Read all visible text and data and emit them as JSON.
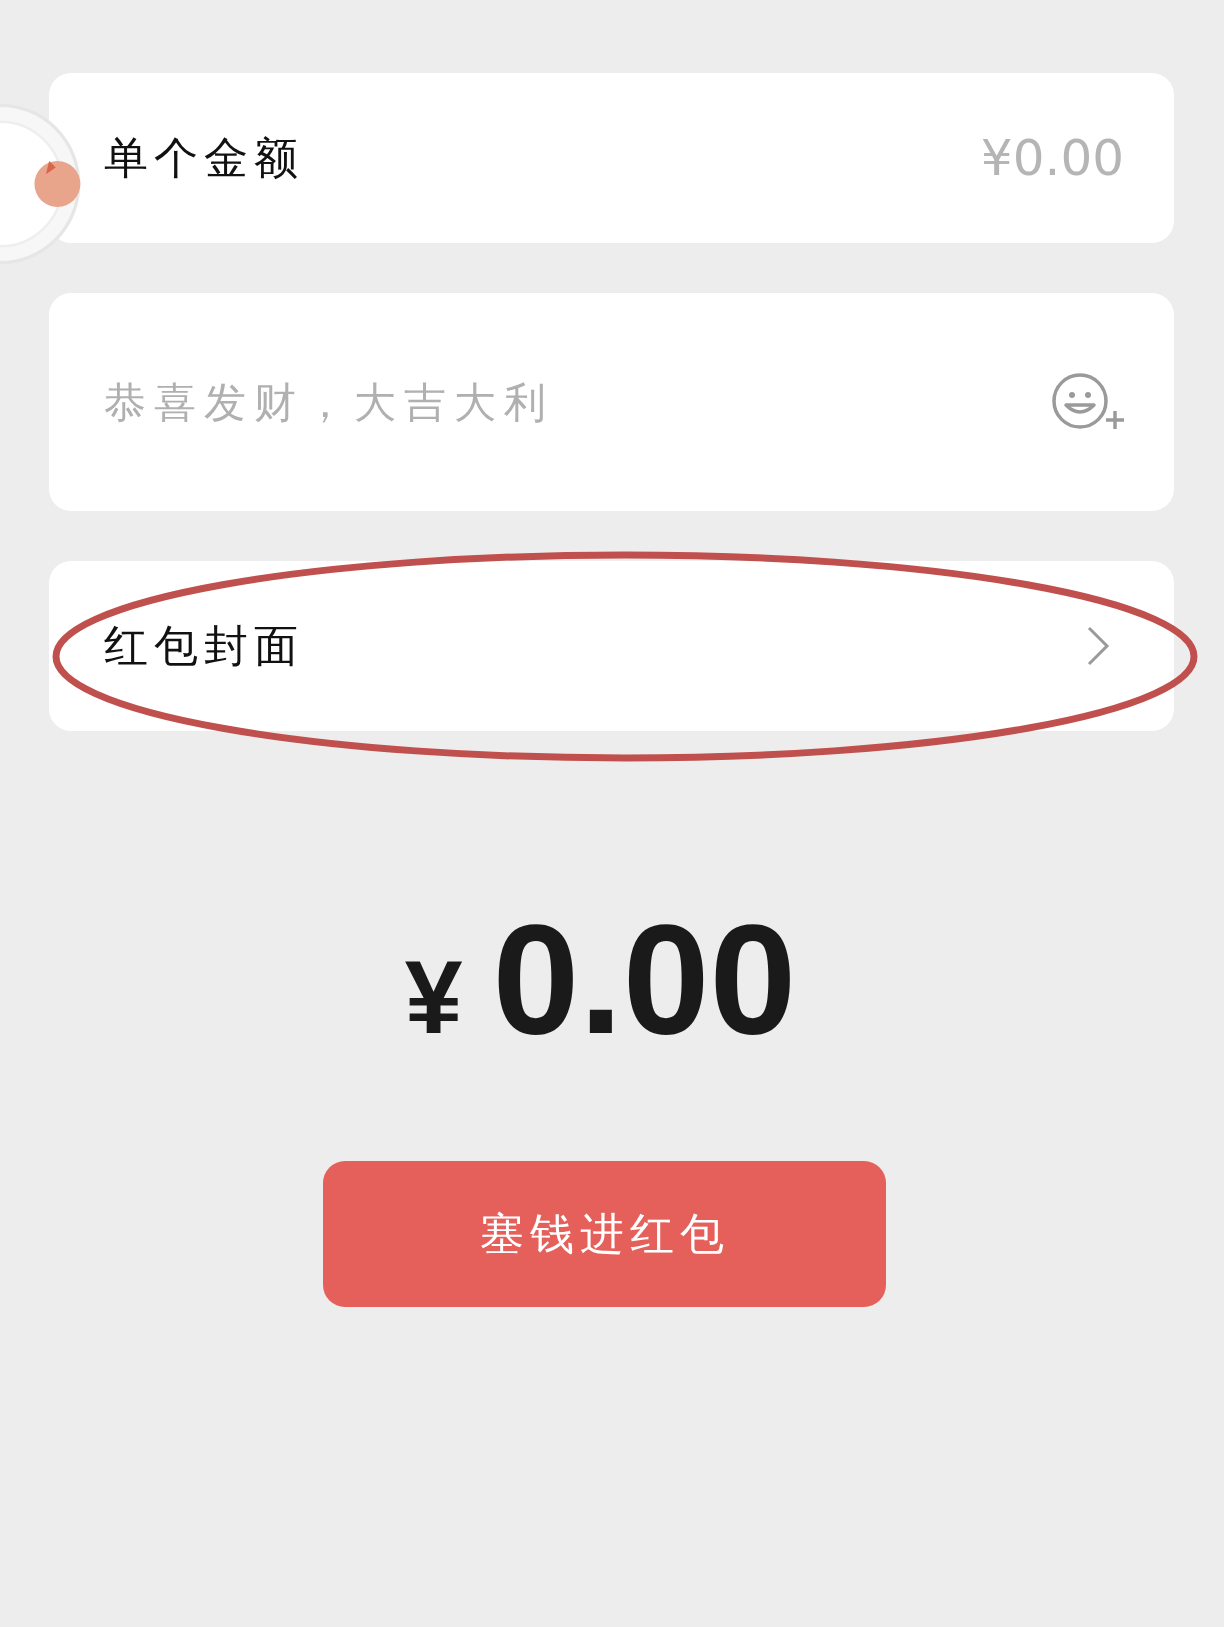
{
  "rows": [
    {
      "kind": "amount",
      "label": "单个金额",
      "value": "¥0.00"
    },
    {
      "kind": "message",
      "placeholder": "恭喜发财，大吉大利"
    },
    {
      "kind": "link",
      "label": "红包封面",
      "highlighted": true
    }
  ],
  "total": {
    "currency": "¥",
    "amount": "0.00"
  },
  "submit_button": "塞钱进红包"
}
